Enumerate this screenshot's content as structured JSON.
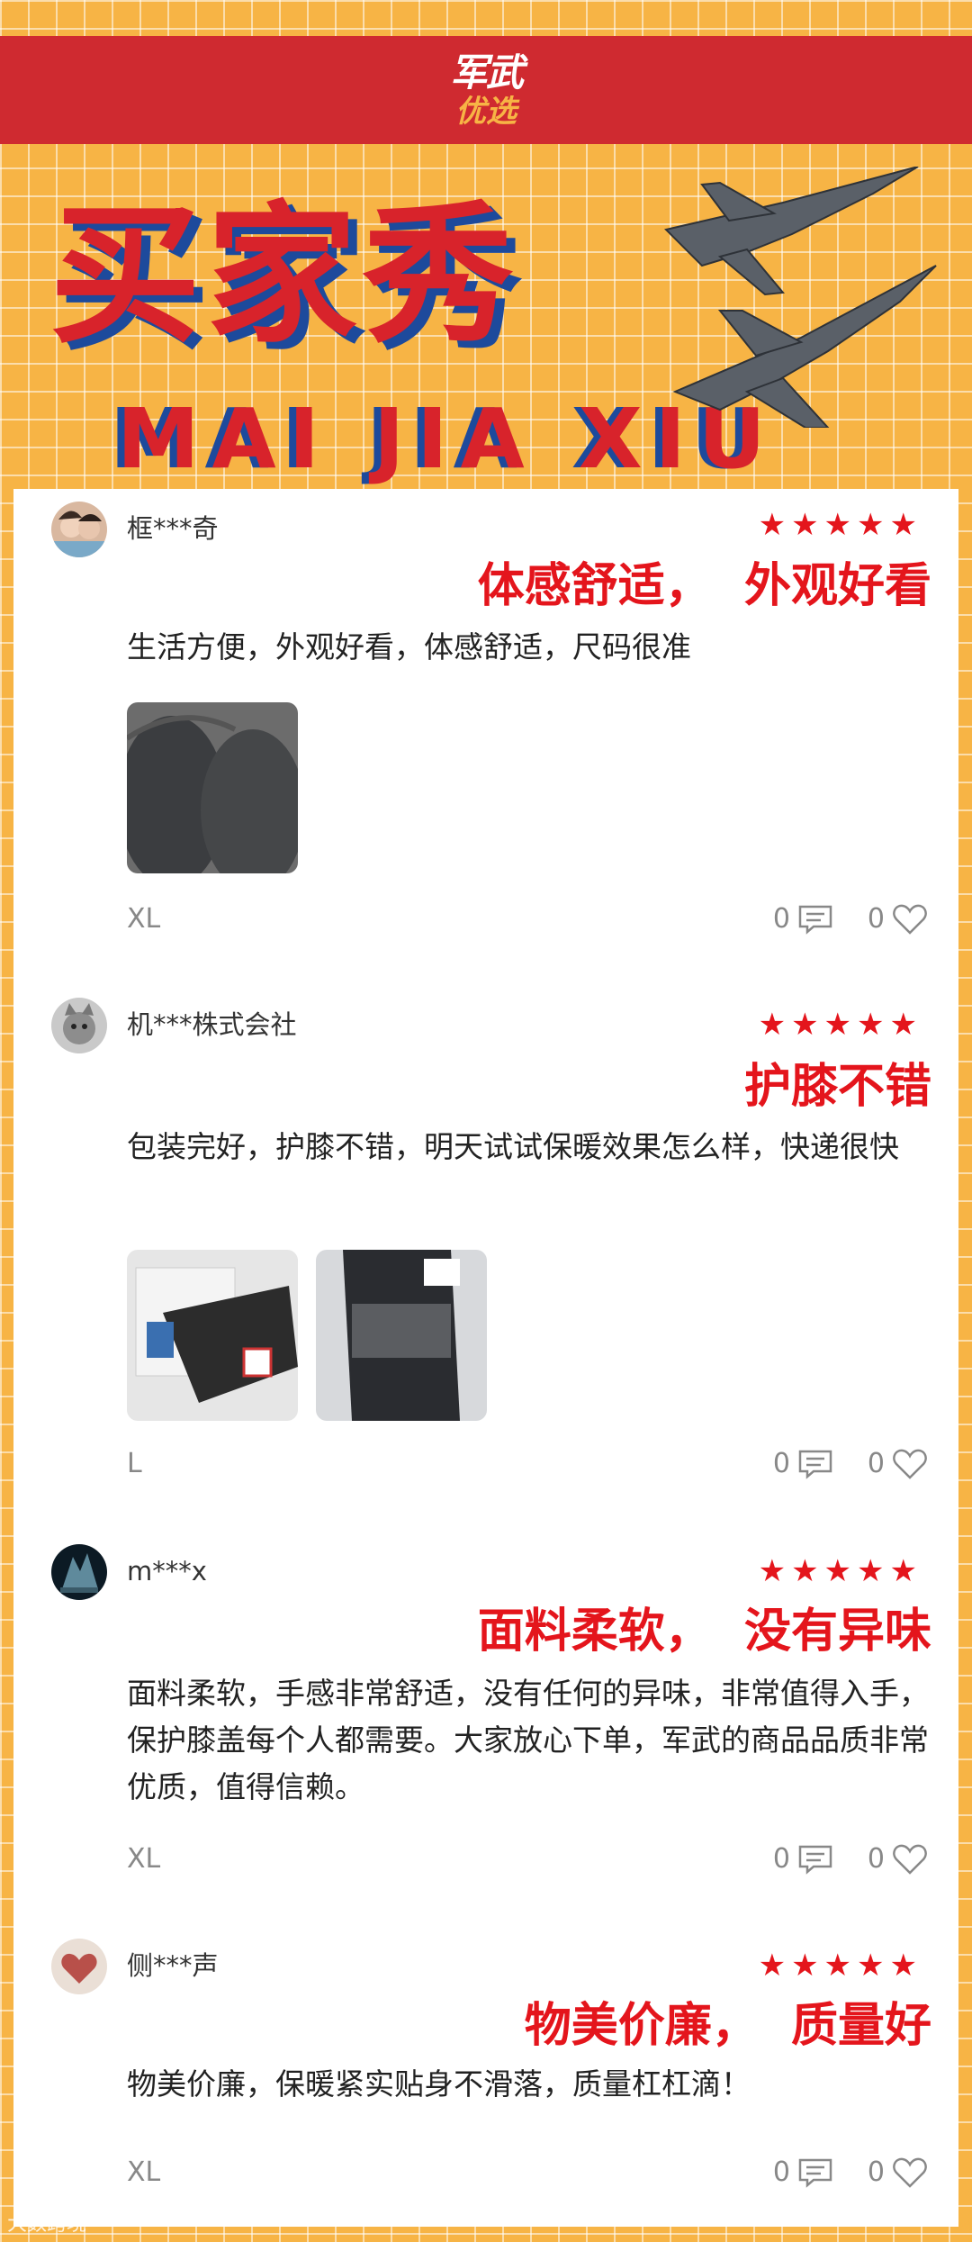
{
  "header": {
    "logo_line1": "军武",
    "logo_line2": "优选",
    "banner_title": "买家秀",
    "banner_subtitle": "MAI JIA XIU"
  },
  "reviews": [
    {
      "username": "框***奇",
      "rating": 5,
      "stars": "★★★★★",
      "headline": "体感舒适，  外观好看",
      "text": "生活方便，外观好看，体感舒适，尺码很准",
      "size": "XL",
      "comment_count": "0",
      "like_count": "0"
    },
    {
      "username": "机***株式会社",
      "rating": 5,
      "stars": "★★★★★",
      "headline": "护膝不错",
      "text": "包装完好，护膝不错，明天试试保暖效果怎么样，快递很快",
      "size": "L",
      "comment_count": "0",
      "like_count": "0"
    },
    {
      "username": "m***x",
      "rating": 5,
      "stars": "★★★★★",
      "headline": "面料柔软，  没有异味",
      "text": "面料柔软，手感非常舒适，没有任何的异味，非常值得入手，保护膝盖每个人都需要。大家放心下单，军武的商品品质非常优质，值得信赖。",
      "size": "XL",
      "comment_count": "0",
      "like_count": "0"
    },
    {
      "username": "侧***声",
      "rating": 5,
      "stars": "★★★★★",
      "headline": "物美价廉，  质量好",
      "text": "物美价廉，保暖紧实贴身不滑落，质量杠杠滴！",
      "size": "XL",
      "comment_count": "0",
      "like_count": "0"
    }
  ],
  "watermark": "大数跨境",
  "icons": [
    "comment-icon",
    "heart-icon",
    "star-icon",
    "jet-icon"
  ],
  "colors": {
    "accent_red": "#e4151c",
    "band_red": "#cf2a30",
    "background": "#f7b445",
    "shadow_blue": "#1d4a9c"
  }
}
